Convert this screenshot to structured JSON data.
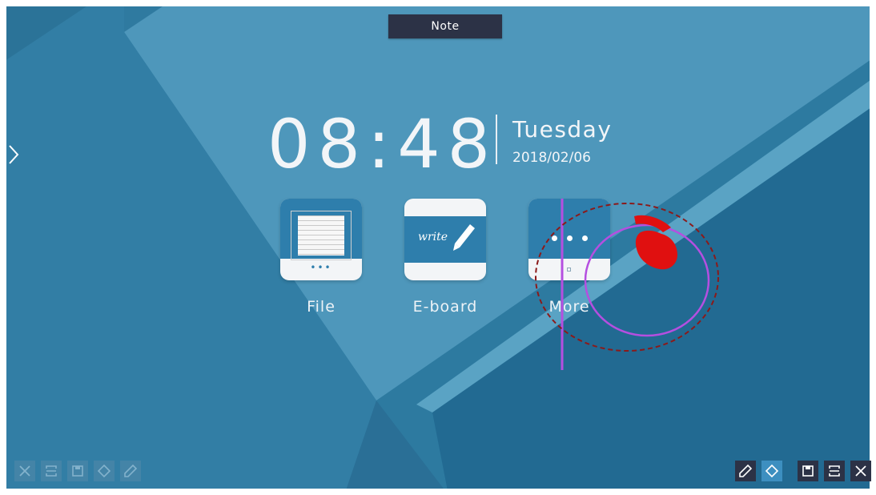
{
  "header": {
    "note_label": "Note"
  },
  "clock": {
    "time": "08:48",
    "weekday": "Tuesday",
    "date": "2018/02/06"
  },
  "apps": [
    {
      "label": "File",
      "icon": "file-icon"
    },
    {
      "label": "E-board",
      "icon": "eboard-icon",
      "icon_text": "write"
    },
    {
      "label": "More",
      "icon": "more-icon"
    }
  ],
  "toolbar_left": [
    "close-icon",
    "crop-icon",
    "save-icon",
    "eraser-icon",
    "pen-icon"
  ],
  "toolbar_right": [
    "pen-icon",
    "eraser-icon",
    "save-icon",
    "crop-icon",
    "close-icon"
  ],
  "annotations": {
    "line_color": "#b54fe0",
    "circle_color": "#b54fe0",
    "dashed_circle_color": "#8b1a1a",
    "hand_color": "#e01010"
  },
  "colors": {
    "background_dark": "#2f7ca2",
    "background_light": "#4e97bb",
    "toolbar_dark": "#2c3246",
    "toolbar_active": "#3d8fc0"
  }
}
